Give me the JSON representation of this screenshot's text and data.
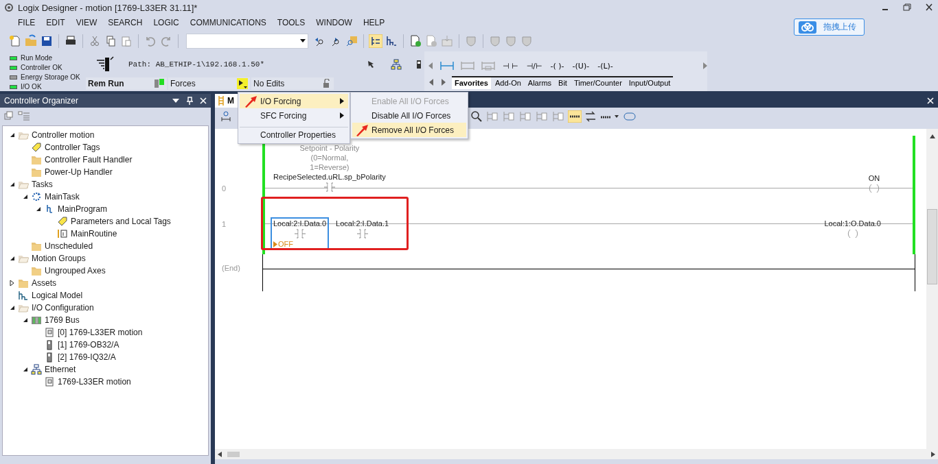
{
  "window": {
    "title": "Logix Designer - motion [1769-L33ER 31.11]*"
  },
  "menu": [
    "FILE",
    "EDIT",
    "VIEW",
    "SEARCH",
    "LOGIC",
    "COMMUNICATIONS",
    "TOOLS",
    "WINDOW",
    "HELP"
  ],
  "upload_button": {
    "label": "拖拽上传"
  },
  "status_lights": [
    {
      "label": "Run Mode",
      "color": "#22dd44"
    },
    {
      "label": "Controller OK",
      "color": "#22dd44"
    },
    {
      "label": "Energy Storage OK",
      "color": "#9a9a9a"
    },
    {
      "label": "I/O OK",
      "color": "#22dd44"
    }
  ],
  "path": {
    "label": "Path:",
    "value": "AB_ETHIP-1\\192.168.1.50*"
  },
  "mode_bar": {
    "mode": "Rem Run",
    "forces": "Forces",
    "edits": "No Edits"
  },
  "instruction_symbols": [
    "⊣ ⊢",
    "⊣/⊢",
    "-( )-",
    "-(U)-",
    "-(L)-"
  ],
  "instruction_tabs": [
    {
      "label": "Favorites",
      "selected": true
    },
    {
      "label": "Add-On",
      "selected": false
    },
    {
      "label": "Alarms",
      "selected": false
    },
    {
      "label": "Bit",
      "selected": false
    },
    {
      "label": "Timer/Counter",
      "selected": false
    },
    {
      "label": "Input/Output",
      "selected": false
    }
  ],
  "organizer": {
    "title": "Controller Organizer",
    "tree": [
      {
        "label": "Controller motion",
        "kind": "folder-open",
        "expanded": true,
        "children": [
          {
            "label": "Controller Tags",
            "kind": "tag"
          },
          {
            "label": "Controller Fault Handler",
            "kind": "folder"
          },
          {
            "label": "Power-Up Handler",
            "kind": "folder"
          }
        ]
      },
      {
        "label": "Tasks",
        "kind": "folder-open",
        "expanded": true,
        "children": [
          {
            "label": "MainTask",
            "kind": "task",
            "expanded": true,
            "children": [
              {
                "label": "MainProgram",
                "kind": "program",
                "expanded": true,
                "children": [
                  {
                    "label": "Parameters and Local Tags",
                    "kind": "tag"
                  },
                  {
                    "label": "MainRoutine",
                    "kind": "routine"
                  }
                ]
              }
            ]
          },
          {
            "label": "Unscheduled",
            "kind": "folder"
          }
        ]
      },
      {
        "label": "Motion Groups",
        "kind": "folder-open",
        "expanded": true,
        "children": [
          {
            "label": "Ungrouped Axes",
            "kind": "folder"
          }
        ]
      },
      {
        "label": "Assets",
        "kind": "folder",
        "expanded": false
      },
      {
        "label": "Logical Model",
        "kind": "model"
      },
      {
        "label": "I/O Configuration",
        "kind": "folder-open",
        "expanded": true,
        "children": [
          {
            "label": "1769 Bus",
            "kind": "bus",
            "expanded": true,
            "children": [
              {
                "label": "[0] 1769-L33ER motion",
                "kind": "controller"
              },
              {
                "label": "[1] 1769-OB32/A",
                "kind": "module"
              },
              {
                "label": "[2] 1769-IQ32/A",
                "kind": "module"
              }
            ]
          },
          {
            "label": "Ethernet",
            "kind": "network",
            "expanded": true,
            "children": [
              {
                "label": "1769-L33ER motion",
                "kind": "controller"
              }
            ]
          }
        ]
      }
    ]
  },
  "editor": {
    "tab_label": "M",
    "end_label": "(End)",
    "rungs": [
      {
        "number": "0",
        "powered": true,
        "highlighted": false,
        "contacts": [
          {
            "tag": "RecipeSelected.uRL.sp_bPolarity",
            "comment": [
              "Setpoint - Polarity",
              "(0=Normal,",
              "1=Reverse)"
            ],
            "selected": false
          }
        ],
        "coil": {
          "tag": "ON"
        }
      },
      {
        "number": "1",
        "powered": true,
        "highlighted": true,
        "contacts": [
          {
            "tag": "Local:2:I.Data.0",
            "selected": true,
            "force_value": "OFF"
          },
          {
            "tag": "Local:2:I.Data.1",
            "selected": false
          }
        ],
        "coil": {
          "tag": "Local:1:O.Data.0"
        }
      }
    ]
  },
  "context_menu": {
    "items": [
      {
        "label": "I/O Forcing",
        "submenu": true,
        "highlighted": true,
        "annotated": true,
        "separator_before": false
      },
      {
        "label": "SFC Forcing",
        "submenu": true,
        "highlighted": false,
        "annotated": false,
        "separator_before": false
      },
      {
        "label": "Controller Properties",
        "submenu": false,
        "highlighted": false,
        "annotated": false,
        "separator_before": true
      }
    ],
    "submenu": [
      {
        "label": "Enable All I/O Forces",
        "disabled": true,
        "highlighted": false,
        "annotated": false
      },
      {
        "label": "Disable All I/O Forces",
        "disabled": false,
        "highlighted": false,
        "annotated": false
      },
      {
        "label": "Remove All I/O Forces",
        "disabled": false,
        "highlighted": true,
        "annotated": true
      }
    ]
  }
}
